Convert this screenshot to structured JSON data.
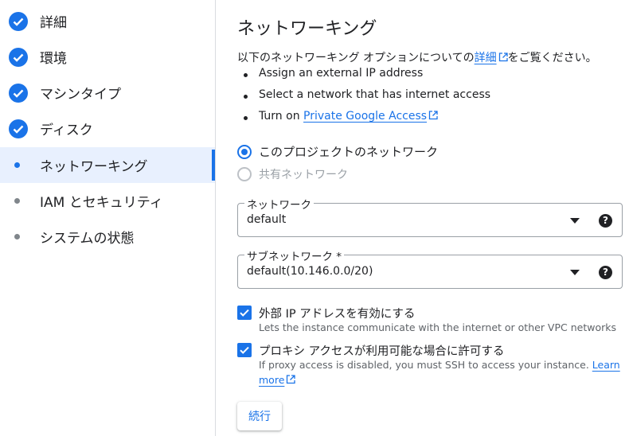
{
  "sidebar": {
    "items": [
      {
        "label": "詳細",
        "state": "done"
      },
      {
        "label": "環境",
        "state": "done"
      },
      {
        "label": "マシンタイプ",
        "state": "done"
      },
      {
        "label": "ディスク",
        "state": "done"
      },
      {
        "label": "ネットワーキング",
        "state": "active"
      },
      {
        "label": "IAM とセキュリティ",
        "state": "pending"
      },
      {
        "label": "システムの状態",
        "state": "pending"
      }
    ]
  },
  "main": {
    "title": "ネットワーキング",
    "intro": {
      "before": "以下のネットワーキング オプションについての",
      "link": "詳細",
      "after": "をご覧ください。"
    },
    "bullets": {
      "b1": "Assign an external IP address",
      "b2": "Select a network that has internet access",
      "b3_prefix": "Turn on ",
      "b3_link": "Private Google Access"
    },
    "radios": {
      "project_network": "このプロジェクトのネットワーク",
      "shared_network": "共有ネットワーク",
      "selected": "project_network"
    },
    "network_field": {
      "label": "ネットワーク",
      "value": "default"
    },
    "subnet_field": {
      "label": "サブネットワーク *",
      "value": "default(10.146.0.0/20)"
    },
    "checkbox_external_ip": {
      "label": "外部 IP アドレスを有効にする",
      "desc": "Lets the instance communicate with the internet or other VPC networks",
      "checked": true
    },
    "checkbox_proxy": {
      "label": "プロキシ アクセスが利用可能な場合に許可する",
      "desc": "If proxy access is disabled, you must SSH to access your instance.",
      "learn": "Learn",
      "more": "more",
      "checked": true
    },
    "continue_button": "続行"
  },
  "colors": {
    "accent": "#1a73e8",
    "active_bg": "#e8f0fe",
    "muted_text": "#5f6368",
    "border": "#dadce0"
  }
}
